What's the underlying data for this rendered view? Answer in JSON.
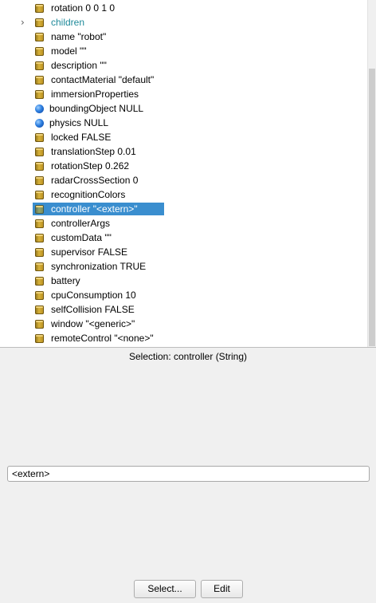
{
  "tree": {
    "rows": [
      {
        "label": "rotation 0 0 1 0",
        "icon": "field-cylinder-icon",
        "kind": "field"
      },
      {
        "label": "children",
        "icon": "field-cylinder-icon",
        "kind": "link",
        "expandable": true
      },
      {
        "label": "name \"robot\"",
        "icon": "field-cylinder-icon",
        "kind": "field"
      },
      {
        "label": "model \"\"",
        "icon": "field-cylinder-icon",
        "kind": "field"
      },
      {
        "label": "description \"\"",
        "icon": "field-cylinder-icon",
        "kind": "field"
      },
      {
        "label": "contactMaterial \"default\"",
        "icon": "field-cylinder-icon",
        "kind": "field"
      },
      {
        "label": "immersionProperties",
        "icon": "field-cylinder-icon",
        "kind": "field"
      },
      {
        "label": "boundingObject NULL",
        "icon": "node-sphere-icon",
        "kind": "node"
      },
      {
        "label": "physics NULL",
        "icon": "node-sphere-icon",
        "kind": "node"
      },
      {
        "label": "locked FALSE",
        "icon": "field-cylinder-icon",
        "kind": "field"
      },
      {
        "label": "translationStep 0.01",
        "icon": "field-cylinder-icon",
        "kind": "field"
      },
      {
        "label": "rotationStep 0.262",
        "icon": "field-cylinder-icon",
        "kind": "field"
      },
      {
        "label": "radarCrossSection 0",
        "icon": "field-cylinder-icon",
        "kind": "field"
      },
      {
        "label": "recognitionColors",
        "icon": "field-cylinder-icon",
        "kind": "field"
      },
      {
        "label": "controller \"<extern>\"",
        "icon": "field-cylinder-icon",
        "kind": "field",
        "selected": true
      },
      {
        "label": "controllerArgs",
        "icon": "field-cylinder-icon",
        "kind": "field"
      },
      {
        "label": "customData \"\"",
        "icon": "field-cylinder-icon",
        "kind": "field"
      },
      {
        "label": "supervisor FALSE",
        "icon": "field-cylinder-icon",
        "kind": "field"
      },
      {
        "label": "synchronization TRUE",
        "icon": "field-cylinder-icon",
        "kind": "field"
      },
      {
        "label": "battery",
        "icon": "field-cylinder-icon",
        "kind": "field"
      },
      {
        "label": "cpuConsumption 10",
        "icon": "field-cylinder-icon",
        "kind": "field"
      },
      {
        "label": "selfCollision FALSE",
        "icon": "field-cylinder-icon",
        "kind": "field"
      },
      {
        "label": "window \"<generic>\"",
        "icon": "field-cylinder-icon",
        "kind": "field"
      },
      {
        "label": "remoteControl \"<none>\"",
        "icon": "field-cylinder-icon",
        "kind": "field"
      }
    ],
    "expand_arrow": "›"
  },
  "selection": {
    "title": "Selection: controller (String)",
    "value": "<extern>"
  },
  "buttons": {
    "select_label": "Select...",
    "edit_label": "Edit"
  },
  "colors": {
    "selection_highlight": "#3a8ecf",
    "link_text": "#1f8a9a",
    "panel_background": "#f0f0f0"
  }
}
